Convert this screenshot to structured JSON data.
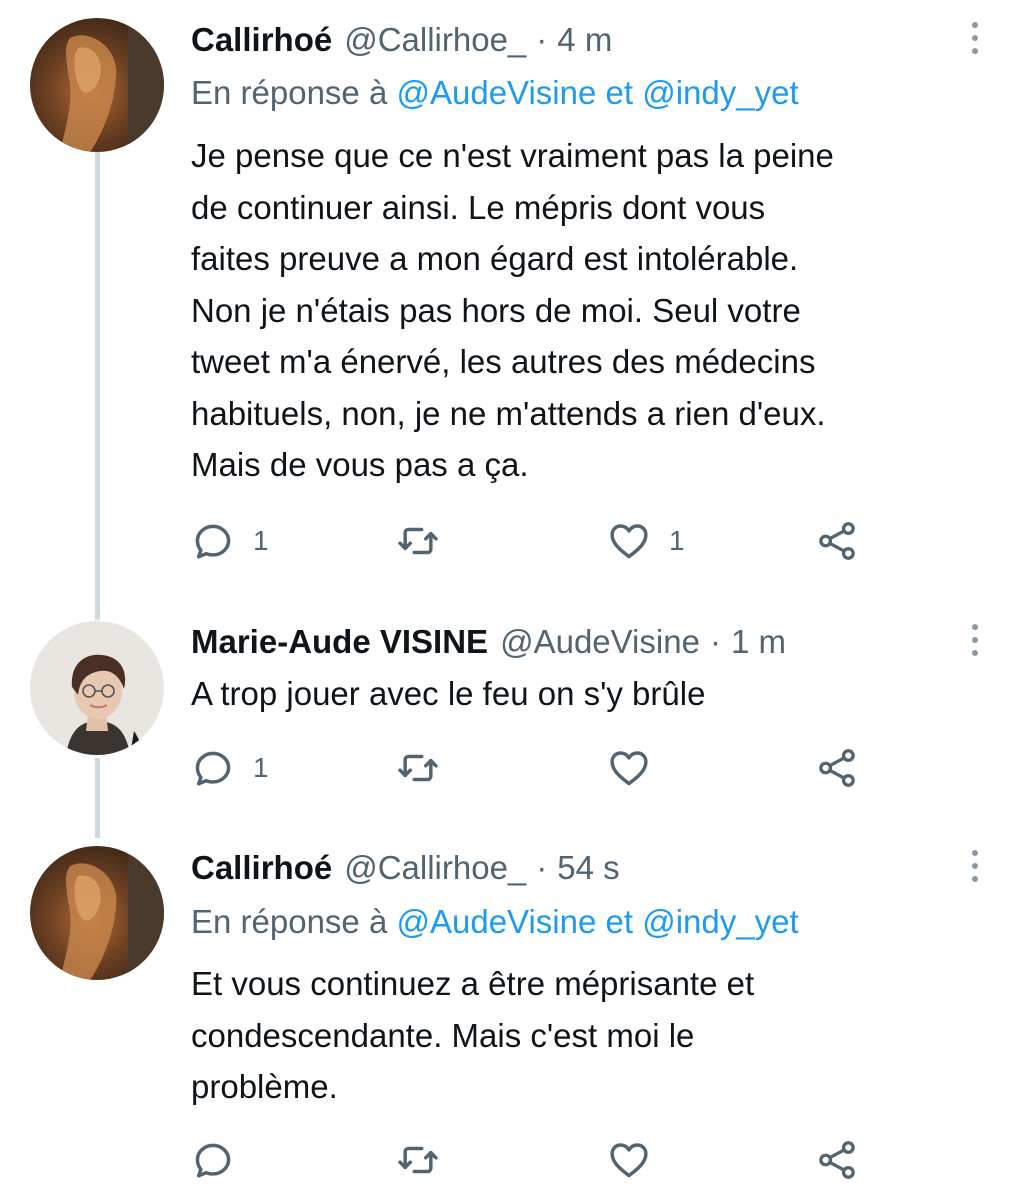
{
  "tweets": [
    {
      "author": "Callirhoé",
      "handle": "@Callirhoe_",
      "separator": "·",
      "time": "4 m",
      "reply_prefix": "En réponse à",
      "reply_user1": "@AudeVisine",
      "reply_join": "et",
      "reply_user2": "@indy_yet",
      "text_lines": [
        "Je pense que ce n'est vraiment pas la peine",
        "de continuer ainsi. Le mépris dont vous",
        "faites preuve a mon égard est intolérable.",
        "Non je n'étais pas hors de moi. Seul votre",
        "tweet m'a énervé, les autres des médecins",
        "habituels, non, je ne m'attends a rien d'eux.",
        "Mais de vous pas a ça."
      ],
      "reply_count": "1",
      "retweet_count": "",
      "like_count": "1"
    },
    {
      "author": "Marie-Aude VISINE",
      "handle": "@AudeVisine",
      "separator": "·",
      "time": "1 m",
      "text_lines": [
        "A trop jouer avec le feu on s'y brûle"
      ],
      "reply_count": "1",
      "retweet_count": "",
      "like_count": ""
    },
    {
      "author": "Callirhoé",
      "handle": "@Callirhoe_",
      "separator": "·",
      "time": "54 s",
      "reply_prefix": "En réponse à",
      "reply_user1": "@AudeVisine",
      "reply_join": "et",
      "reply_user2": "@indy_yet",
      "text_lines": [
        "Et vous continuez a être méprisante et",
        "condescendante. Mais c'est moi le",
        "problème."
      ],
      "reply_count": "",
      "retweet_count": "",
      "like_count": ""
    }
  ],
  "icons": {
    "reply": "reply-icon",
    "retweet": "retweet-icon",
    "like": "heart-icon",
    "share": "share-icon",
    "more": "more-options-icon"
  },
  "colors": {
    "text": "#0f1419",
    "secondary": "#536471",
    "link": "#1d9bf0",
    "thread_line": "#cfd9de"
  }
}
